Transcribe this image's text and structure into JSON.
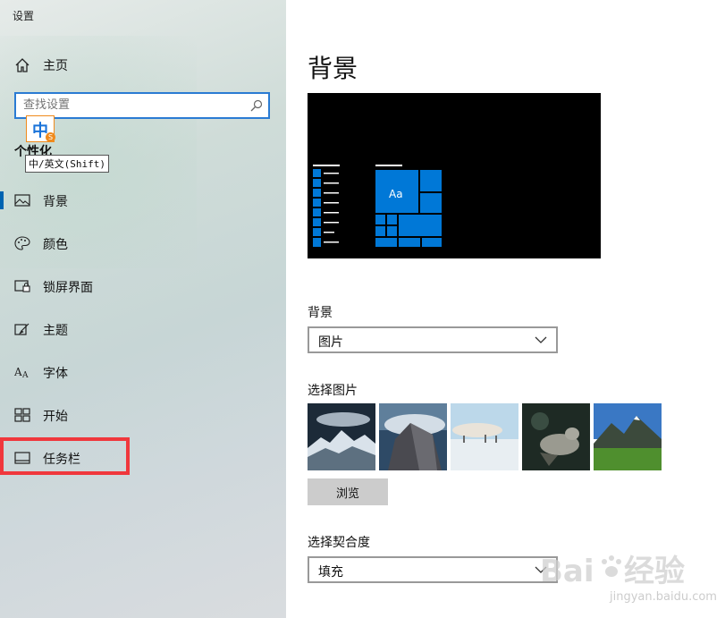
{
  "app": {
    "title": "设置"
  },
  "sidebar": {
    "home_label": "主页",
    "search": {
      "placeholder": "查找设置"
    },
    "ime": {
      "char": "中",
      "badge": "S",
      "tooltip": "中/英文(Shift)"
    },
    "section_title": "个性化",
    "items": [
      {
        "label": "背景",
        "icon": "image-icon",
        "active": true
      },
      {
        "label": "颜色",
        "icon": "palette-icon",
        "active": false
      },
      {
        "label": "锁屏界面",
        "icon": "lock-screen-icon",
        "active": false
      },
      {
        "label": "主题",
        "icon": "theme-brush-icon",
        "active": false
      },
      {
        "label": "字体",
        "icon": "font-icon",
        "active": false
      },
      {
        "label": "开始",
        "icon": "start-grid-icon",
        "active": false
      },
      {
        "label": "任务栏",
        "icon": "taskbar-icon",
        "active": false
      }
    ]
  },
  "main": {
    "page_title": "背景",
    "preview": {
      "tile_label": "Aa"
    },
    "background_label": "背景",
    "background_value": "图片",
    "choose_picture_label": "选择图片",
    "browse_label": "浏览",
    "fit_label": "选择契合度",
    "fit_value": "填充"
  },
  "colors": {
    "accent": "#0078d7",
    "highlight_box": "#f0373c",
    "ime_orange": "#f08a1c"
  },
  "watermark": {
    "text": "jingyan.baidu.com"
  }
}
